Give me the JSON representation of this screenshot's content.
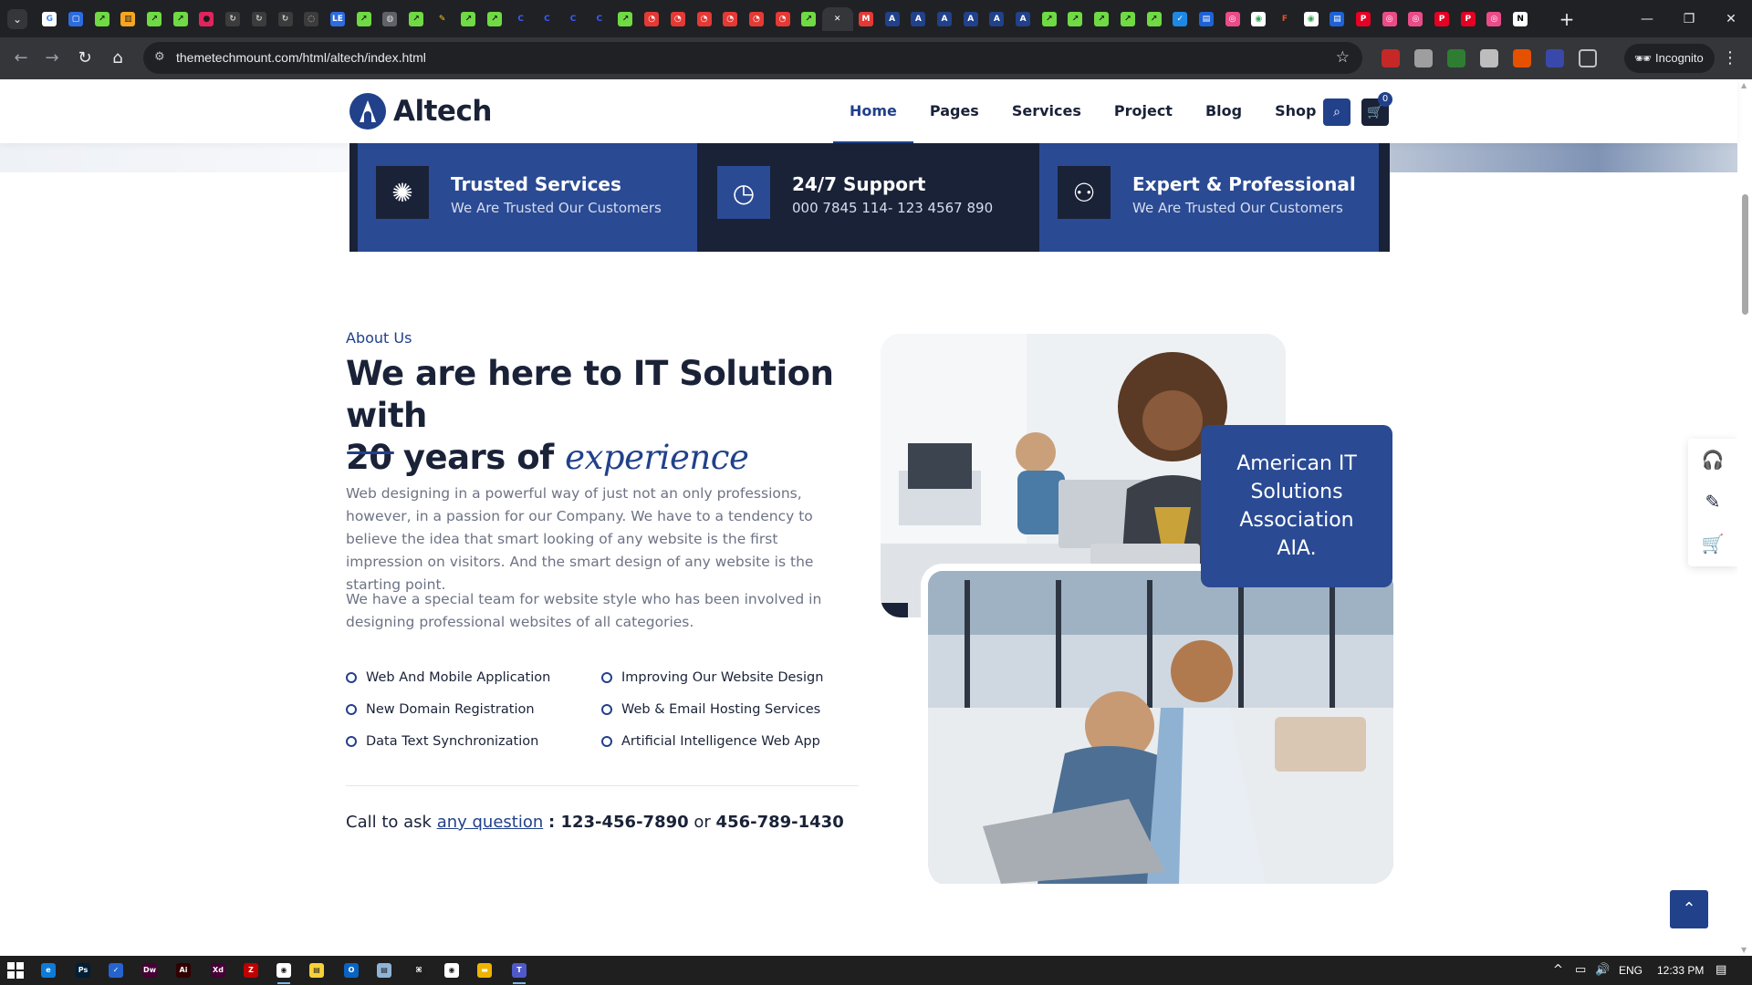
{
  "browser": {
    "tab_icons": [
      {
        "name": "google-tab-icon",
        "color": "#ffffff",
        "glyph": "G",
        "fg": "#4285f4"
      },
      {
        "name": "site-tab-icon",
        "color": "#2d6cdf",
        "glyph": "▢",
        "fg": "#ffffff"
      },
      {
        "name": "upwork-tab-icon",
        "color": "#6fda44",
        "glyph": "↗",
        "fg": "#1a1a1a"
      },
      {
        "name": "store-tab-icon",
        "color": "#f5a623",
        "glyph": "▥",
        "fg": "#1a1a1a"
      },
      {
        "name": "upwork-tab-icon",
        "color": "#6fda44",
        "glyph": "↗",
        "fg": "#1a1a1a"
      },
      {
        "name": "upwork-tab-icon",
        "color": "#6fda44",
        "glyph": "↗",
        "fg": "#1a1a1a"
      },
      {
        "name": "record-tab-icon",
        "color": "#e0245e",
        "glyph": "●",
        "fg": "#1a1a1a"
      },
      {
        "name": "refresh-tab-icon",
        "color": "#3c3c3c",
        "glyph": "↻",
        "fg": "#cccccc"
      },
      {
        "name": "spinner-tab-icon",
        "color": "#3c3c3c",
        "glyph": "↻",
        "fg": "#cccccc"
      },
      {
        "name": "spinner-tab-icon",
        "color": "#3c3c3c",
        "glyph": "↻",
        "fg": "#cccccc"
      },
      {
        "name": "spinner-tab-icon",
        "color": "#3c3c3c",
        "glyph": "◌",
        "fg": "#cccccc"
      },
      {
        "name": "le-tab-icon",
        "color": "#2d6cdf",
        "glyph": "LE",
        "fg": "#ffffff"
      },
      {
        "name": "upwork-tab-icon",
        "color": "#6fda44",
        "glyph": "↗",
        "fg": "#1a1a1a"
      },
      {
        "name": "globe-tab-icon",
        "color": "#5f6368",
        "glyph": "◍",
        "fg": "#dddddd"
      },
      {
        "name": "upwork-tab-icon",
        "color": "#6fda44",
        "glyph": "↗",
        "fg": "#1a1a1a"
      },
      {
        "name": "tool-tab-icon",
        "color": "#202124",
        "glyph": "✎",
        "fg": "#f5c518"
      },
      {
        "name": "upwork-tab-icon",
        "color": "#6fda44",
        "glyph": "↗",
        "fg": "#1a1a1a"
      },
      {
        "name": "upwork-tab-icon",
        "color": "#6fda44",
        "glyph": "↗",
        "fg": "#1a1a1a"
      },
      {
        "name": "c-tab-icon",
        "color": "#202124",
        "glyph": "C",
        "fg": "#3b5bfd"
      },
      {
        "name": "c-tab-icon",
        "color": "#202124",
        "glyph": "C",
        "fg": "#3b5bfd"
      },
      {
        "name": "c-tab-icon",
        "color": "#202124",
        "glyph": "C",
        "fg": "#3b5bfd"
      },
      {
        "name": "c-tab-icon",
        "color": "#202124",
        "glyph": "C",
        "fg": "#3b5bfd"
      },
      {
        "name": "upwork-tab-icon",
        "color": "#6fda44",
        "glyph": "↗",
        "fg": "#1a1a1a"
      },
      {
        "name": "red-tab-icon",
        "color": "#e53935",
        "glyph": "◔",
        "fg": "#ffffff"
      },
      {
        "name": "red-tab-icon",
        "color": "#e53935",
        "glyph": "◔",
        "fg": "#ffffff"
      },
      {
        "name": "red-tab-icon",
        "color": "#e53935",
        "glyph": "◔",
        "fg": "#ffffff"
      },
      {
        "name": "red-tab-icon",
        "color": "#e53935",
        "glyph": "◔",
        "fg": "#ffffff"
      },
      {
        "name": "red-tab-icon",
        "color": "#e53935",
        "glyph": "◔",
        "fg": "#ffffff"
      },
      {
        "name": "red-tab-icon",
        "color": "#e53935",
        "glyph": "◔",
        "fg": "#ffffff"
      },
      {
        "name": "upwork-tab-icon",
        "color": "#6fda44",
        "glyph": "↗",
        "fg": "#1a1a1a"
      }
    ],
    "tab_icons_after": [
      {
        "name": "m-tab-icon",
        "color": "#e53935",
        "glyph": "M",
        "fg": "#ffffff"
      },
      {
        "name": "a-tab-icon",
        "color": "#21418a",
        "glyph": "A",
        "fg": "#ffffff"
      },
      {
        "name": "a-tab-icon",
        "color": "#21418a",
        "glyph": "A",
        "fg": "#ffffff"
      },
      {
        "name": "a-tab-icon",
        "color": "#21418a",
        "glyph": "A",
        "fg": "#ffffff"
      },
      {
        "name": "a-tab-icon",
        "color": "#21418a",
        "glyph": "A",
        "fg": "#ffffff"
      },
      {
        "name": "a-tab-icon",
        "color": "#21418a",
        "glyph": "A",
        "fg": "#ffffff"
      },
      {
        "name": "a-tab-icon",
        "color": "#21418a",
        "glyph": "A",
        "fg": "#ffffff"
      },
      {
        "name": "upwork-tab-icon",
        "color": "#6fda44",
        "glyph": "↗",
        "fg": "#1a1a1a"
      },
      {
        "name": "upwork-tab-icon",
        "color": "#6fda44",
        "glyph": "↗",
        "fg": "#1a1a1a"
      },
      {
        "name": "upwork-tab-icon",
        "color": "#6fda44",
        "glyph": "↗",
        "fg": "#1a1a1a"
      },
      {
        "name": "upwork-tab-icon",
        "color": "#6fda44",
        "glyph": "↗",
        "fg": "#1a1a1a"
      },
      {
        "name": "upwork-tab-icon",
        "color": "#6fda44",
        "glyph": "↗",
        "fg": "#1a1a1a"
      },
      {
        "name": "check-tab-icon",
        "color": "#1e88e5",
        "glyph": "✓",
        "fg": "#ffffff"
      },
      {
        "name": "board-tab-icon",
        "color": "#1e63d6",
        "glyph": "▤",
        "fg": "#ffffff"
      },
      {
        "name": "dribbble-tab-icon",
        "color": "#ea4c89",
        "glyph": "◎",
        "fg": "#ffffff"
      },
      {
        "name": "chrome-tab-icon",
        "color": "#ffffff",
        "glyph": "◉",
        "fg": "#34a853"
      },
      {
        "name": "figma-tab-icon",
        "color": "#202124",
        "glyph": "F",
        "fg": "#f24e1e"
      },
      {
        "name": "chrome-tab-icon",
        "color": "#ffffff",
        "glyph": "◉",
        "fg": "#34a853"
      },
      {
        "name": "board-tab-icon",
        "color": "#1e63d6",
        "glyph": "▤",
        "fg": "#ffffff"
      },
      {
        "name": "pinterest-tab-icon",
        "color": "#e60023",
        "glyph": "P",
        "fg": "#ffffff"
      },
      {
        "name": "dribbble-tab-icon",
        "color": "#ea4c89",
        "glyph": "◎",
        "fg": "#ffffff"
      },
      {
        "name": "dribbble-tab-icon",
        "color": "#ea4c89",
        "glyph": "◎",
        "fg": "#ffffff"
      },
      {
        "name": "pinterest-tab-icon",
        "color": "#e60023",
        "glyph": "P",
        "fg": "#ffffff"
      },
      {
        "name": "pinterest-tab-icon",
        "color": "#e60023",
        "glyph": "P",
        "fg": "#ffffff"
      },
      {
        "name": "dribbble-tab-icon",
        "color": "#ea4c89",
        "glyph": "◎",
        "fg": "#ffffff"
      },
      {
        "name": "notion-tab-icon",
        "color": "#ffffff",
        "glyph": "N",
        "fg": "#000000"
      }
    ],
    "url": "themetechmount.com/html/altech/index.html",
    "incognito_label": "Incognito"
  },
  "site": {
    "logo_text": "Altech",
    "nav": [
      "Home",
      "Pages",
      "Services",
      "Project",
      "Blog",
      "Shop"
    ],
    "active_nav": "Home",
    "cart_count": "0",
    "brand_color": "#21418a",
    "dark_color": "#1a2238"
  },
  "features": [
    {
      "title": "Trusted Services",
      "subtitle": "We Are Trusted Our Customers",
      "icon": "network-icon"
    },
    {
      "title": "24/7 Support",
      "subtitle": "000 7845 114- 123 4567 890",
      "icon": "support-24-icon"
    },
    {
      "title": "Expert & Professional",
      "subtitle": "We Are Trusted Our Customers",
      "icon": "expert-icon"
    }
  ],
  "about": {
    "tag": "About Us",
    "title_line1": "We are here to IT Solution with",
    "title_line2": "20 years of",
    "title_accent": "experience",
    "para1": "Web designing in a powerful way of just not an only professions, however, in a passion for our Company. We have to a tendency to believe the idea that smart looking of any website is the first impression on visitors. And the smart design of any website is the starting point.",
    "para2": "We have a special team for website style who has been involved in designing professional websites of all categories.",
    "checklist": [
      "Web And Mobile Application",
      "Improving Our Website Design",
      "New Domain Registration",
      "Web & Email Hosting Services",
      "Data Text Synchronization",
      "Artificial Intelligence Web App"
    ],
    "call_prefix": "Call to ask",
    "call_link": "any question",
    "phone1": ": 123-456-7890",
    "call_or": "or",
    "phone2": "456-789-1430",
    "badge_text": "American IT Solutions Association AIA."
  },
  "taskbar": {
    "apps": [
      {
        "name": "edge-taskbar-icon",
        "color": "#0f7bd8",
        "glyph": "e"
      },
      {
        "name": "photoshop-taskbar-icon",
        "color": "#001e36",
        "glyph": "Ps"
      },
      {
        "name": "todo-taskbar-icon",
        "color": "#2564cf",
        "glyph": "✓"
      },
      {
        "name": "dreamweaver-taskbar-icon",
        "color": "#470137",
        "glyph": "Dw"
      },
      {
        "name": "illustrator-taskbar-icon",
        "color": "#330000",
        "glyph": "Ai"
      },
      {
        "name": "xd-taskbar-icon",
        "color": "#470137",
        "glyph": "Xd"
      },
      {
        "name": "filezilla-taskbar-icon",
        "color": "#bf0000",
        "glyph": "Z"
      },
      {
        "name": "chrome-taskbar-icon",
        "color": "#ffffff",
        "glyph": "◉",
        "active": true
      },
      {
        "name": "sticky-notes-taskbar-icon",
        "color": "#f7d139",
        "glyph": "▤"
      },
      {
        "name": "outlook-taskbar-icon",
        "color": "#0a64c2",
        "glyph": "O"
      },
      {
        "name": "notepad-taskbar-icon",
        "color": "#8fb4d8",
        "glyph": "▤"
      },
      {
        "name": "vscode-taskbar-icon",
        "color": "#1e1e1e",
        "glyph": "⌘"
      },
      {
        "name": "chrome-taskbar-icon",
        "color": "#ffffff",
        "glyph": "◉"
      },
      {
        "name": "explorer-taskbar-icon",
        "color": "#f0b400",
        "glyph": "▬"
      },
      {
        "name": "teams-taskbar-icon",
        "color": "#5059c9",
        "glyph": "T",
        "active": true
      }
    ],
    "language": "ENG",
    "time": "12:33 PM"
  }
}
